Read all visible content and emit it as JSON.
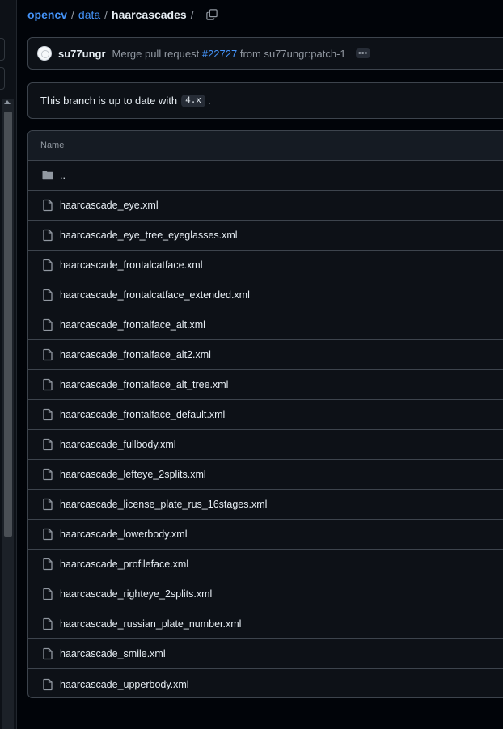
{
  "breadcrumb": {
    "repo": "opencv",
    "folder": "data",
    "current": "haarcascades",
    "separator": "/"
  },
  "commit": {
    "author": "su77ungr",
    "message_prefix": "Merge pull request",
    "pr_number": "#22727",
    "message_suffix": "from su77ungr:patch-1",
    "more_label": "•••"
  },
  "branch_status": {
    "text_prefix": "This branch is up to date with",
    "branch": "4.x",
    "text_suffix": "."
  },
  "table": {
    "header": "Name",
    "parent_label": "..",
    "files": [
      "haarcascade_eye.xml",
      "haarcascade_eye_tree_eyeglasses.xml",
      "haarcascade_frontalcatface.xml",
      "haarcascade_frontalcatface_extended.xml",
      "haarcascade_frontalface_alt.xml",
      "haarcascade_frontalface_alt2.xml",
      "haarcascade_frontalface_alt_tree.xml",
      "haarcascade_frontalface_default.xml",
      "haarcascade_fullbody.xml",
      "haarcascade_lefteye_2splits.xml",
      "haarcascade_license_plate_rus_16stages.xml",
      "haarcascade_lowerbody.xml",
      "haarcascade_profileface.xml",
      "haarcascade_righteye_2splits.xml",
      "haarcascade_russian_plate_number.xml",
      "haarcascade_smile.xml",
      "haarcascade_upperbody.xml"
    ]
  },
  "icons": {
    "copy": "copy-icon",
    "folder": "folder-icon",
    "file": "file-icon"
  },
  "colors": {
    "link": "#4493f8",
    "background": "#010409",
    "panel": "#0d1117",
    "border": "#3d444d"
  }
}
